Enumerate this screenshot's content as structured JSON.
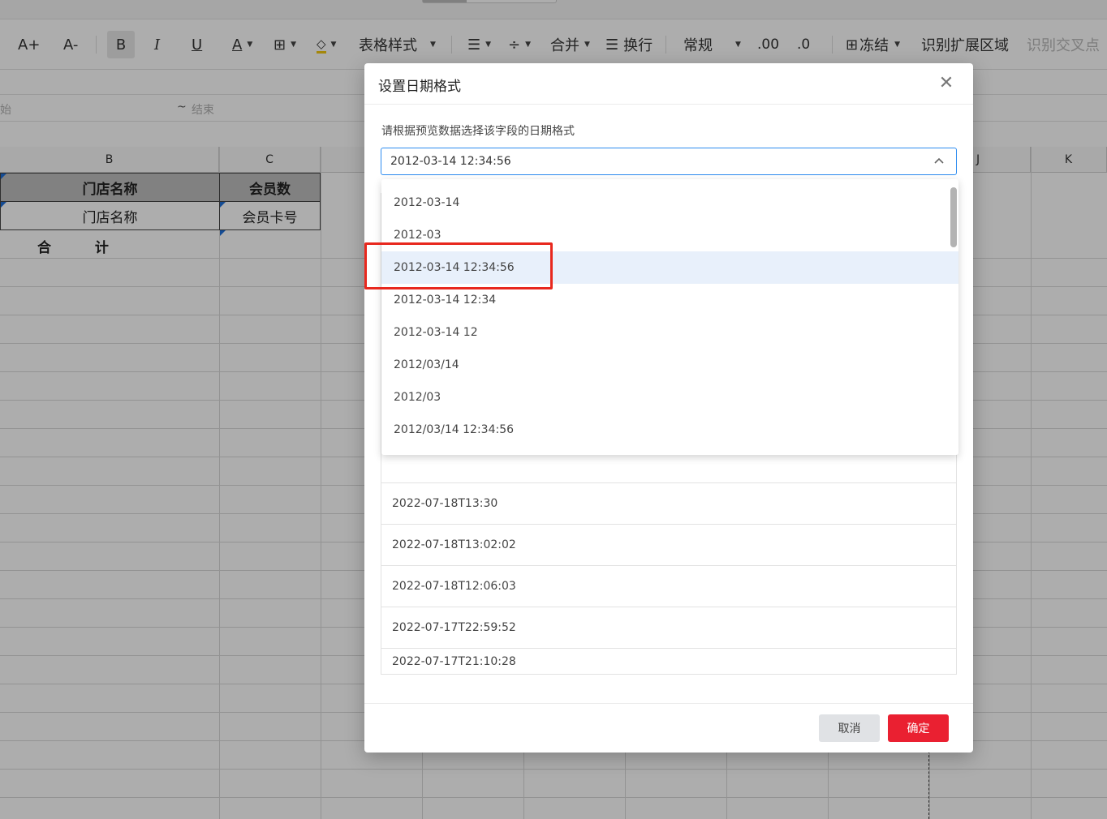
{
  "toolbar": {
    "font_increase": "A+",
    "font_decrease": "A-",
    "bold": "B",
    "italic": "I",
    "underline": "U",
    "font_color": "A",
    "table_style": "表格样式",
    "merge": "合并",
    "wrap": "换行",
    "number_format": "常规",
    "decimal_add": ".00",
    "decimal_remove": ".0",
    "freeze": "冻结",
    "detect_range": "识别扩展区域",
    "detect_cross": "识别交叉点"
  },
  "range_bar": {
    "start_fragment": "始",
    "separator": "~",
    "end_placeholder": "结束"
  },
  "sheet": {
    "columns": [
      "B",
      "C",
      "J",
      "K"
    ],
    "header_row": [
      "门店名称",
      "会员数"
    ],
    "field_row": [
      "门店名称",
      "会员卡号"
    ],
    "total_label": "合 计"
  },
  "modal": {
    "title": "设置日期格式",
    "instruction": "请根据预览数据选择该字段的日期格式",
    "selected_format": "2012-03-14 12:34:56",
    "format_options": [
      "2012-03-14",
      "2012-03",
      "2012-03-14 12:34:56",
      "2012-03-14 12:34",
      "2012-03-14 12",
      "2012/03/14",
      "2012/03",
      "2012/03/14 12:34:56"
    ],
    "preview_rows": [
      "2022-07-18T13:30",
      "2022-07-18T13:02:02",
      "2022-07-18T12:06:03",
      "2022-07-17T22:59:52",
      "2022-07-17T21:10:28"
    ],
    "cancel_label": "取消",
    "confirm_label": "确定"
  },
  "colors": {
    "accent_blue": "#2d8cf0",
    "confirm_red": "#ea2031",
    "annotation_red": "#e8281e",
    "selected_option_bg": "#e8f0fb"
  }
}
